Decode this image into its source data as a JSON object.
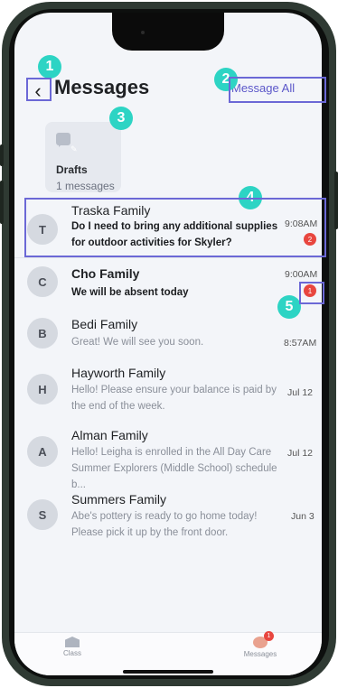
{
  "header": {
    "title": "Messages",
    "back_icon": "chevron-left-icon",
    "message_all_label": "Message All"
  },
  "drafts": {
    "title": "Drafts",
    "count": "1 messages",
    "icon": "pencil-chat-icon"
  },
  "conversations": [
    {
      "initial": "T",
      "name": "Traska Family",
      "preview": "Do I need to bring any additional supplies for outdoor activities for Skyler?",
      "time": "9:08AM",
      "unread": "2"
    },
    {
      "initial": "C",
      "name": "Cho Family",
      "preview": "We will be absent today",
      "time": "9:00AM",
      "unread": "1"
    },
    {
      "initial": "B",
      "name": "Bedi Family",
      "preview": "Great! We will see you soon.",
      "time": "8:57AM"
    },
    {
      "initial": "H",
      "name": "Hayworth Family",
      "preview": "Hello! Please ensure your balance is paid by the end of the week.",
      "time": "Jul 12"
    },
    {
      "initial": "A",
      "name": "Alman Family",
      "preview": "Hello! Leigha is enrolled in the All Day Care Summer Explorers (Middle School) schedule b...",
      "time": "Jul 12"
    },
    {
      "initial": "S",
      "name": "Summers Family",
      "preview": "Abe's pottery is ready to go home today! Please pick it up by the front door.",
      "time": "Jun 3"
    }
  ],
  "tabbar": {
    "class_label": "Class",
    "messages_label": "Messages",
    "messages_badge": "1"
  },
  "annotations": [
    "1",
    "2",
    "3",
    "4",
    "5"
  ],
  "colors": {
    "accent": "#5b57c9",
    "annotation": "#2dd4c4",
    "badge": "#e8463f"
  }
}
